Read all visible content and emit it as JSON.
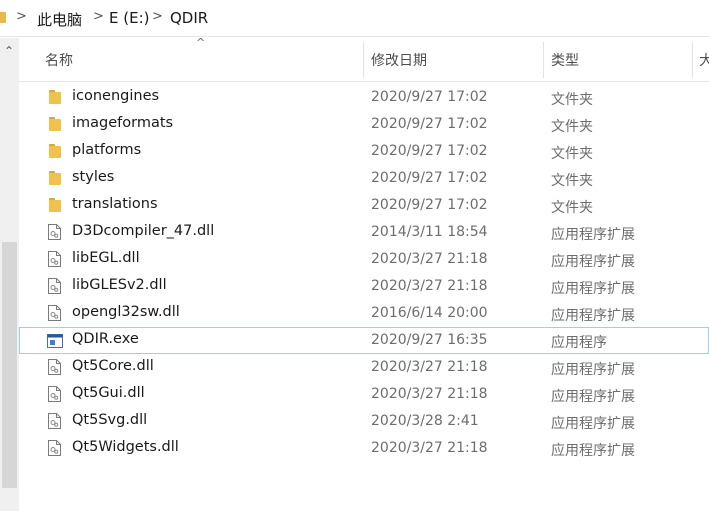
{
  "breadcrumb": {
    "items": [
      "此电脑",
      "E (E:)",
      "QDIR"
    ],
    "separator": ">"
  },
  "columns": {
    "name": "名称",
    "modified": "修改日期",
    "type": "类型",
    "size": "大"
  },
  "sort_indicator": "^",
  "rows": [
    {
      "icon": "folder-icon",
      "name": "iconengines",
      "modified": "2020/9/27 17:02",
      "type": "文件夹"
    },
    {
      "icon": "folder-icon",
      "name": "imageformats",
      "modified": "2020/9/27 17:02",
      "type": "文件夹"
    },
    {
      "icon": "folder-icon",
      "name": "platforms",
      "modified": "2020/9/27 17:02",
      "type": "文件夹"
    },
    {
      "icon": "folder-icon",
      "name": "styles",
      "modified": "2020/9/27 17:02",
      "type": "文件夹"
    },
    {
      "icon": "folder-icon",
      "name": "translations",
      "modified": "2020/9/27 17:02",
      "type": "文件夹"
    },
    {
      "icon": "dll-file-icon",
      "name": "D3Dcompiler_47.dll",
      "modified": "2014/3/11 18:54",
      "type": "应用程序扩展"
    },
    {
      "icon": "dll-file-icon",
      "name": "libEGL.dll",
      "modified": "2020/3/27 21:18",
      "type": "应用程序扩展"
    },
    {
      "icon": "dll-file-icon",
      "name": "libGLESv2.dll",
      "modified": "2020/3/27 21:18",
      "type": "应用程序扩展"
    },
    {
      "icon": "dll-file-icon",
      "name": "opengl32sw.dll",
      "modified": "2016/6/14 20:00",
      "type": "应用程序扩展"
    },
    {
      "icon": "exe-file-icon",
      "name": "QDIR.exe",
      "modified": "2020/9/27 16:35",
      "type": "应用程序",
      "selected": true
    },
    {
      "icon": "dll-file-icon",
      "name": "Qt5Core.dll",
      "modified": "2020/3/27 21:18",
      "type": "应用程序扩展"
    },
    {
      "icon": "dll-file-icon",
      "name": "Qt5Gui.dll",
      "modified": "2020/3/27 21:18",
      "type": "应用程序扩展"
    },
    {
      "icon": "dll-file-icon",
      "name": "Qt5Svg.dll",
      "modified": "2020/3/28 2:41",
      "type": "应用程序扩展"
    },
    {
      "icon": "dll-file-icon",
      "name": "Qt5Widgets.dll",
      "modified": "2020/3/27 21:18",
      "type": "应用程序扩展"
    }
  ],
  "colors": {
    "folder": "#f0c24d",
    "selection_border": "#9ecdf0",
    "nav_strip": "#f0f0f0"
  }
}
